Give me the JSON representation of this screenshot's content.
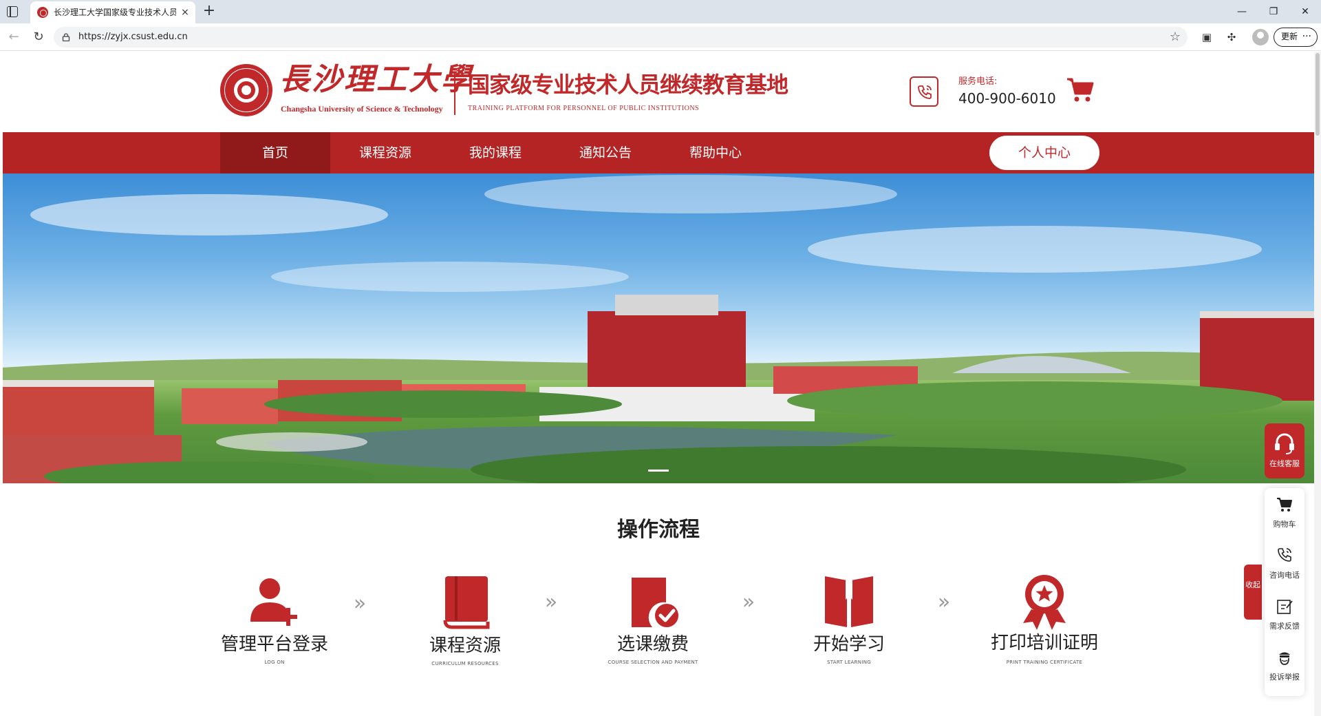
{
  "browser": {
    "tab_title": "长沙理工大学国家级专业技术人员",
    "tab_close": "×",
    "new_tab": "+",
    "url": "https://zyjx.csust.edu.cn",
    "update_label": "更新",
    "update_more": "···",
    "window_controls": {
      "minimize": "—",
      "restore": "❐",
      "close": "✕"
    }
  },
  "header": {
    "logo_cn": "長沙理工大學",
    "logo_en": "Changsha University of Science & Technology",
    "base_title": "国家级专业技术人员继续教育基地",
    "base_subtitle": "TRAINING PLATFORM FOR PERSONNEL OF PUBLIC INSTITUTIONS",
    "phone_label": "服务电话:",
    "phone_number": "400-900-6010"
  },
  "nav": {
    "items": [
      {
        "label": "首页",
        "active": true
      },
      {
        "label": "课程资源",
        "active": false
      },
      {
        "label": "我的课程",
        "active": false
      },
      {
        "label": "通知公告",
        "active": false
      },
      {
        "label": "帮助中心",
        "active": false
      }
    ],
    "user_center": "个人中心"
  },
  "process": {
    "title": "操作流程",
    "steps": [
      {
        "label": "管理平台登录",
        "sub": "LOG ON",
        "icon": "user-add-icon"
      },
      {
        "label": "课程资源",
        "sub": "CURRICULUM RESOURCES",
        "icon": "book-icon"
      },
      {
        "label": "选课缴费",
        "sub": "COURSE SELECTION AND PAYMENT",
        "icon": "selection-payment-icon"
      },
      {
        "label": "开始学习",
        "sub": "START  LEARNING",
        "icon": "open-book-icon"
      },
      {
        "label": "打印培训证明",
        "sub": "PRINT TRAINING CERTIFICATE",
        "icon": "award-icon"
      }
    ],
    "separator": "»"
  },
  "side_widgets": {
    "online_service": "在线客服",
    "collapse": "收起",
    "items": [
      {
        "label": "购物车",
        "icon": "cart-icon"
      },
      {
        "label": "咨询电话",
        "icon": "phone-icon"
      },
      {
        "label": "需求反馈",
        "icon": "edit-icon"
      },
      {
        "label": "投诉举报",
        "icon": "report-icon"
      }
    ]
  },
  "colors": {
    "brand_red": "#c0282a",
    "nav_red": "#b52424",
    "nav_active": "#901a1a"
  }
}
